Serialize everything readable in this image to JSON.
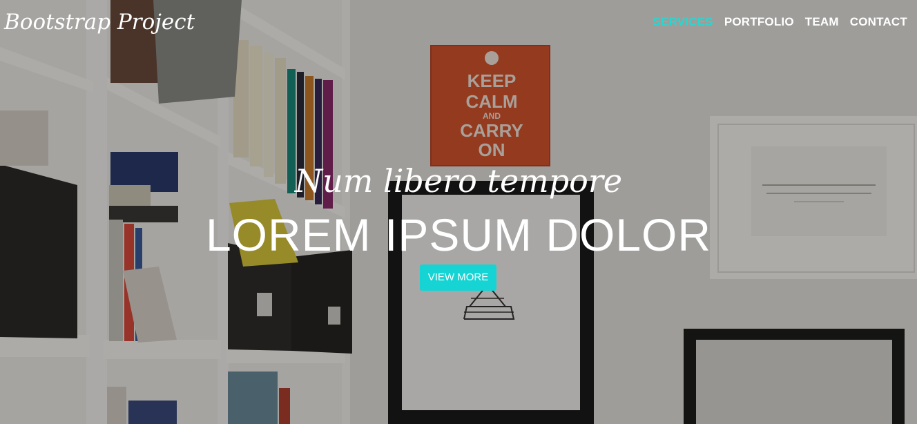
{
  "brand": {
    "name": "Bootstrap Project"
  },
  "nav": {
    "items": [
      {
        "label": "SERVICES",
        "active": true
      },
      {
        "label": "PORTFOLIO",
        "active": false
      },
      {
        "label": "TEAM",
        "active": false
      },
      {
        "label": "CONTACT",
        "active": false
      }
    ]
  },
  "hero": {
    "subtitle": "Num libero tempore",
    "headline": "LOREM IPSUM DOLOR",
    "cta_label": "VIEW MORE",
    "poster_lines": [
      "KEEP",
      "CALM",
      "AND",
      "CARRY",
      "ON"
    ]
  },
  "colors": {
    "accent": "#16d4d4",
    "nav_active": "#2ad6d0",
    "poster": "#d5532c"
  }
}
